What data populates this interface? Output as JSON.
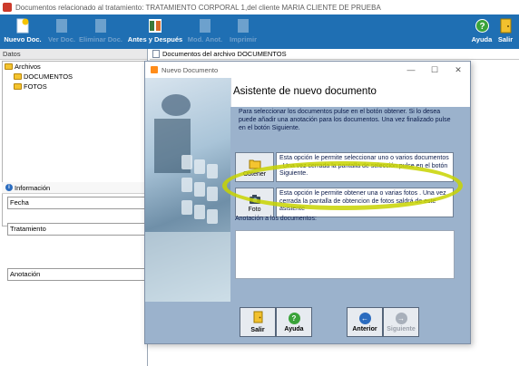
{
  "window": {
    "title": "Documentos relacionado al tratamiento: TRATAMIENTO CORPORAL 1,del cliente MARIA CLIENTE DE PRUEBA"
  },
  "toolbar": {
    "nuevo_doc": "Nuevo Doc.",
    "ver_doc": "Ver Doc.",
    "eliminar_doc": "Eliminar Doc.",
    "antes_despues": "Antes y Después",
    "modificar": "Mod. Anot.",
    "imprimir": "Imprimir",
    "ayuda": "Ayuda",
    "salir": "Salir"
  },
  "left_panel": {
    "header": "Datos",
    "tree_root": "Archivos",
    "tree_items": [
      "DOCUMENTOS",
      "FOTOS"
    ],
    "info_header": "Información",
    "fields": {
      "fecha": "Fecha",
      "tratamiento": "Tratamiento",
      "anotacion": "Anotación"
    }
  },
  "main": {
    "header": "Documentos del archivo DOCUMENTOS"
  },
  "dialog": {
    "window_title": "Nuevo Documento",
    "heading": "Asistente de nuevo documento",
    "intro": "Para seleccionar los documentos pulse en el botón obtener. Si lo desea puede añadir una anotación para los documentos. Una vez finalizado pulse en el botón Siguiente.",
    "option_obtener": {
      "label": "Obtener",
      "description": "Esta opción le permite seleccionar uno o varios documentos . Una vez cerrada la pantalla de selección pulse en el botón Siguiente."
    },
    "option_foto": {
      "label": "Foto",
      "description": "Esta opción le permite obtener una o varias fotos . Una vez cerrada la pantalla de obtencion de fotos saldrá de este asistente"
    },
    "annotation_label": "Anotación a los documentos:",
    "annotation_value": "",
    "buttons": {
      "salir": "Salir",
      "ayuda": "Ayuda",
      "anterior": "Anterior",
      "siguiente": "Siguiente"
    }
  },
  "colors": {
    "toolbar_bg": "#1f6fb3",
    "dialog_bg": "#9bb2cc",
    "highlight": "#c8d400"
  }
}
